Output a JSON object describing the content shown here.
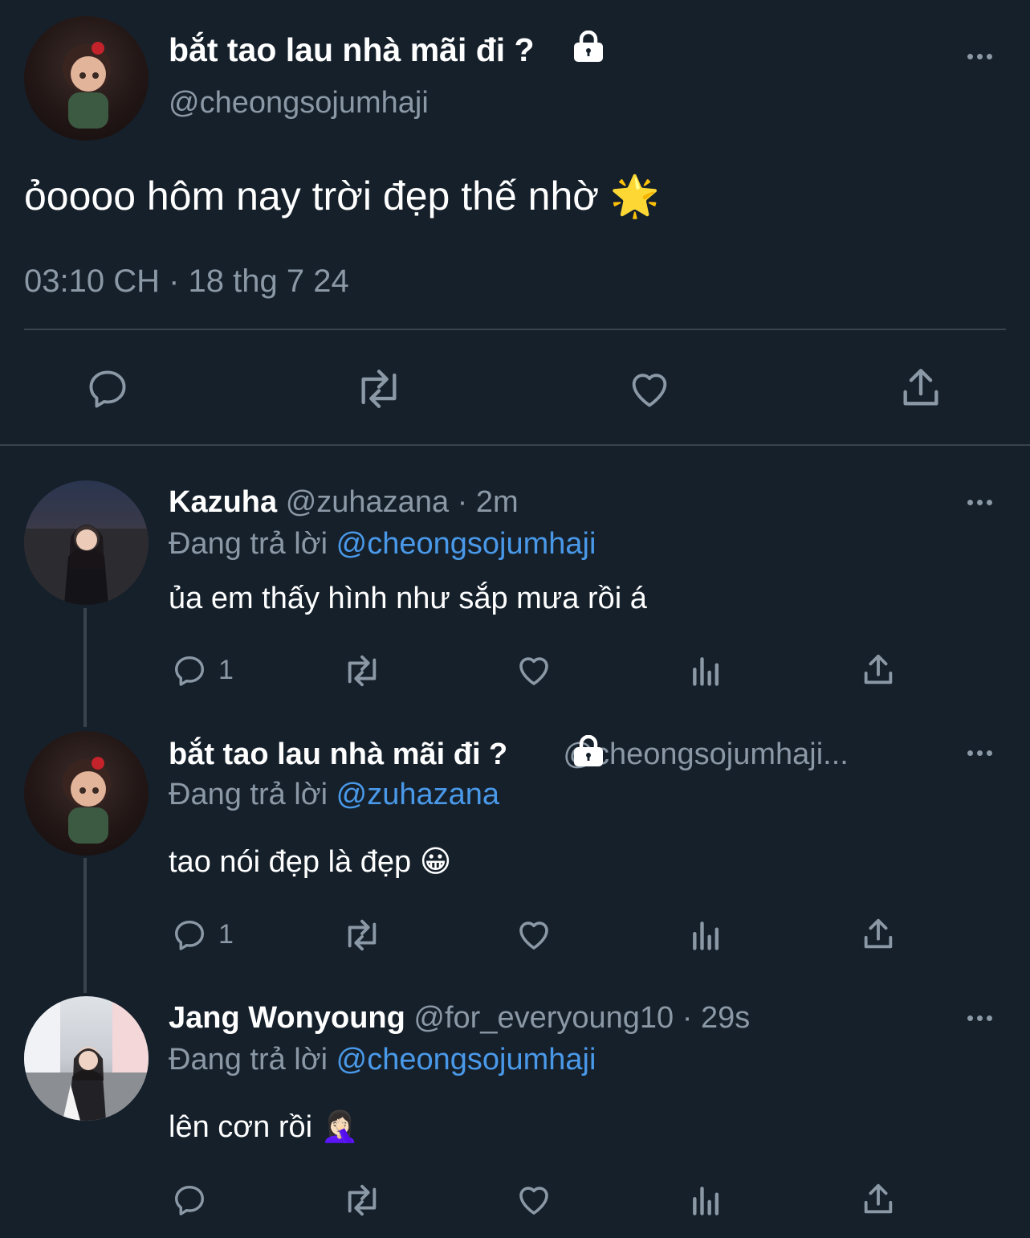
{
  "main_tweet": {
    "display_name": "bắt tao lau nhà mãi đi ?",
    "handle": "@cheongsojumhaji",
    "text": "ỏoooo hôm nay trời đẹp thế nhờ 🌟",
    "timestamp": "03:10 CH · 18 thg 7 24",
    "lock_icon": "lock-icon"
  },
  "replies": [
    {
      "display_name": "Kazuha",
      "handle_time": "@zuhazana · 2m",
      "replying_prefix": "Đang trả lời",
      "replying_to": "@cheongsojumhaji",
      "text": "ủa em thấy hình như sắp mưa rồi á",
      "reply_count": "1"
    },
    {
      "display_name": "bắt tao lau nhà mãi đi ?",
      "handle_time": "@cheongsojumhaji...",
      "replying_prefix": "Đang trả lời",
      "replying_to": "@zuhazana",
      "text": "tao nói đẹp là đẹp 😀",
      "reply_count": "1"
    },
    {
      "display_name": "Jang Wonyoung",
      "handle_time": "@for_everyoung10 · 29s",
      "replying_prefix": "Đang trả lời",
      "replying_to": "@cheongsojumhaji",
      "text": "lên cơn rồi 🤦🏻‍♀️",
      "reply_count": ""
    }
  ],
  "colors": {
    "background": "#15202b",
    "text": "#ffffff",
    "muted": "#8b98a5",
    "link": "#4a99e9",
    "divider": "#38444d"
  }
}
